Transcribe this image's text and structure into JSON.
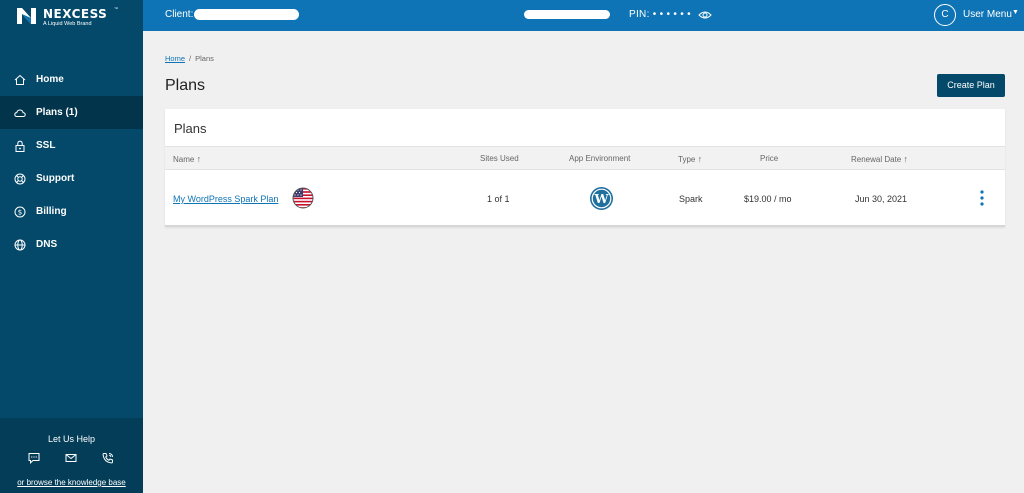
{
  "brand": {
    "name": "NEXCESS",
    "tm": "™",
    "tagline": "A Liquid Web Brand"
  },
  "header": {
    "client_label": "Client:",
    "pin_label": "PIN: • • • • • •",
    "avatar_initial": "C",
    "user_menu": "User Menu",
    "caret": "▼"
  },
  "sidebar": {
    "items": [
      {
        "label": "Home",
        "icon": "home-icon"
      },
      {
        "label": "Plans (1)",
        "icon": "cloud-icon",
        "active": true
      },
      {
        "label": "SSL",
        "icon": "lock-icon"
      },
      {
        "label": "Support",
        "icon": "lifebuoy-icon"
      },
      {
        "label": "Billing",
        "icon": "dollar-icon"
      },
      {
        "label": "DNS",
        "icon": "globe-icon"
      }
    ],
    "help": {
      "title": "Let Us Help",
      "icons": [
        "chat-icon",
        "mail-icon",
        "phone-icon"
      ],
      "link": "or browse the knowledge base"
    }
  },
  "breadcrumb": {
    "home": "Home",
    "separator": "/",
    "current": "Plans"
  },
  "page": {
    "title": "Plans",
    "create_button": "Create Plan"
  },
  "table": {
    "title": "Plans",
    "columns": {
      "name": "Name",
      "sites_used": "Sites Used",
      "app_env": "App Environment",
      "type": "Type",
      "price": "Price",
      "renewal": "Renewal Date"
    },
    "sort_arrow": "↑",
    "rows": [
      {
        "name": "My WordPress Spark Plan",
        "flag": "us-flag-icon",
        "sites_used": "1 of 1",
        "app_env": "wordpress-icon",
        "type": "Spark",
        "price": "$19.00 / mo",
        "renewal": "Jun 30, 2021"
      }
    ]
  },
  "colors": {
    "topbar": "#0f74b5",
    "sidebar": "#04496a",
    "sidebar_active": "#02344b",
    "accent": "#0f74b5"
  }
}
